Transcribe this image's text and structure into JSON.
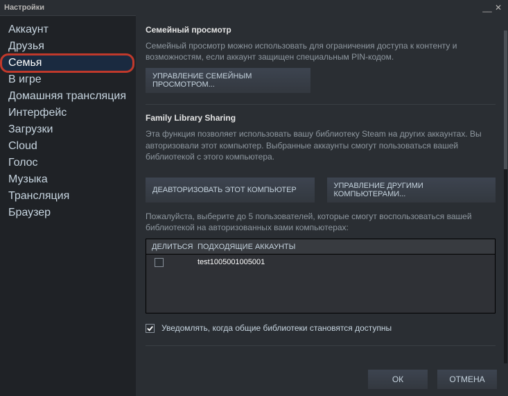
{
  "window": {
    "title": "Настройки"
  },
  "sidebar": {
    "items": [
      {
        "label": "Аккаунт"
      },
      {
        "label": "Друзья"
      },
      {
        "label": "Семья"
      },
      {
        "label": "В игре"
      },
      {
        "label": "Домашняя трансляция"
      },
      {
        "label": "Интерфейс"
      },
      {
        "label": "Загрузки"
      },
      {
        "label": "Cloud"
      },
      {
        "label": "Голос"
      },
      {
        "label": "Музыка"
      },
      {
        "label": "Трансляция"
      },
      {
        "label": "Браузер"
      }
    ]
  },
  "family_view": {
    "title": "Семейный просмотр",
    "desc": "Семейный просмотр можно использовать для ограничения доступа к контенту и возможностям, если аккаунт защищен специальным PIN-кодом.",
    "manage_btn": "УПРАВЛЕНИЕ СЕМЕЙНЫМ ПРОСМОТРОМ..."
  },
  "sharing": {
    "title": "Family Library Sharing",
    "desc": "Эта функция позволяет использовать вашу библиотеку Steam на других аккаунтах. Вы авторизовали этот компьютер. Выбранные аккаунты смогут пользоваться вашей библиотекой с этого компьютера.",
    "deauth_btn": "ДЕАВТОРИЗОВАТЬ ЭТОТ КОМПЬЮТЕР",
    "manage_others_btn": "УПРАВЛЕНИЕ ДРУГИМИ КОМПЬЮТЕРАМИ...",
    "select_hint": "Пожалуйста, выберите до 5 пользователей, которые смогут воспользоваться вашей библиотекой на авторизованных вами компьютерах:",
    "col_share": "ДЕЛИТЬСЯ",
    "col_accounts": "ПОДХОДЯЩИЕ АККАУНТЫ",
    "rows": [
      {
        "account": "test1005001005001",
        "shared": false
      }
    ],
    "notify_label": "Уведомлять, когда общие библиотеки становятся доступны",
    "notify_checked": true
  },
  "footer": {
    "ok": "ОК",
    "cancel": "ОТМЕНА"
  }
}
